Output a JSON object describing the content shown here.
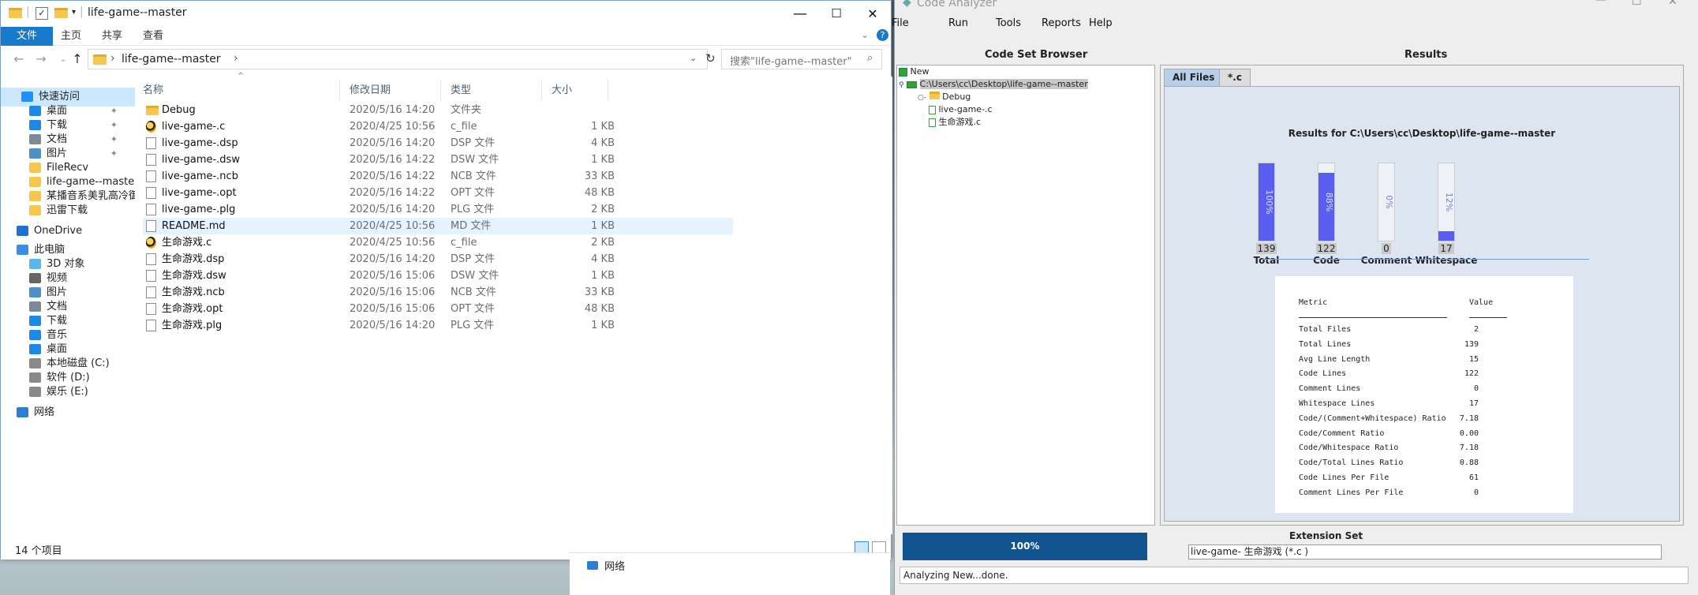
{
  "explorer": {
    "title": "life-game--master",
    "window_controls": [
      "—",
      "☐",
      "✕"
    ],
    "ribbon_tabs": [
      "文件",
      "主页",
      "共享",
      "查看"
    ],
    "address": "life-game--master",
    "search_placeholder": "搜索\"life-game--master\"",
    "sidebar": [
      {
        "label": "快速访问",
        "icon": "star-icon",
        "pinned": false,
        "selected": true
      },
      {
        "label": "桌面",
        "icon": "desktop-icon",
        "pinned": true
      },
      {
        "label": "下载",
        "icon": "download-icon",
        "pinned": true
      },
      {
        "label": "文档",
        "icon": "document-icon",
        "pinned": true
      },
      {
        "label": "图片",
        "icon": "picture-icon",
        "pinned": true
      },
      {
        "label": "FileRecv",
        "icon": "folder-icon"
      },
      {
        "label": "life-game--master",
        "icon": "folder-icon"
      },
      {
        "label": "某播音系美乳高冷御",
        "icon": "folder-icon"
      },
      {
        "label": "迅雷下载",
        "icon": "folder-icon"
      },
      {
        "label": "OneDrive",
        "icon": "cloud-icon"
      },
      {
        "label": "此电脑",
        "icon": "computer-icon"
      },
      {
        "label": "3D 对象",
        "icon": "cube-icon"
      },
      {
        "label": "视频",
        "icon": "video-icon"
      },
      {
        "label": "图片",
        "icon": "picture-icon"
      },
      {
        "label": "文档",
        "icon": "document-icon"
      },
      {
        "label": "下载",
        "icon": "download-icon"
      },
      {
        "label": "音乐",
        "icon": "music-icon"
      },
      {
        "label": "桌面",
        "icon": "desktop-icon"
      },
      {
        "label": "本地磁盘 (C:)",
        "icon": "drive-icon"
      },
      {
        "label": "软件 (D:)",
        "icon": "drive-icon"
      },
      {
        "label": "娱乐 (E:)",
        "icon": "drive-icon"
      },
      {
        "label": "网络",
        "icon": "network-icon"
      }
    ],
    "columns": [
      "名称",
      "修改日期",
      "类型",
      "大小"
    ],
    "files": [
      {
        "name": "Debug",
        "date": "2020/5/16 14:20",
        "type": "文件夹",
        "size": "",
        "icon": "folder"
      },
      {
        "name": "live-game-.c",
        "date": "2020/4/25 10:56",
        "type": "c_file",
        "size": "1 KB",
        "icon": "cfile"
      },
      {
        "name": "live-game-.dsp",
        "date": "2020/5/16 14:20",
        "type": "DSP 文件",
        "size": "4 KB",
        "icon": "doc"
      },
      {
        "name": "live-game-.dsw",
        "date": "2020/5/16 14:22",
        "type": "DSW 文件",
        "size": "1 KB",
        "icon": "doc"
      },
      {
        "name": "live-game-.ncb",
        "date": "2020/5/16 14:22",
        "type": "NCB 文件",
        "size": "33 KB",
        "icon": "doc"
      },
      {
        "name": "live-game-.opt",
        "date": "2020/5/16 14:22",
        "type": "OPT 文件",
        "size": "48 KB",
        "icon": "doc"
      },
      {
        "name": "live-game-.plg",
        "date": "2020/5/16 14:20",
        "type": "PLG 文件",
        "size": "2 KB",
        "icon": "doc"
      },
      {
        "name": "README.md",
        "date": "2020/4/25 10:56",
        "type": "MD 文件",
        "size": "1 KB",
        "icon": "doc",
        "hover": true
      },
      {
        "name": "生命游戏.c",
        "date": "2020/4/25 10:56",
        "type": "c_file",
        "size": "2 KB",
        "icon": "cfile"
      },
      {
        "name": "生命游戏.dsp",
        "date": "2020/5/16 14:20",
        "type": "DSP 文件",
        "size": "4 KB",
        "icon": "doc"
      },
      {
        "name": "生命游戏.dsw",
        "date": "2020/5/16 15:06",
        "type": "DSW 文件",
        "size": "1 KB",
        "icon": "doc"
      },
      {
        "name": "生命游戏.ncb",
        "date": "2020/5/16 15:06",
        "type": "NCB 文件",
        "size": "33 KB",
        "icon": "doc"
      },
      {
        "name": "生命游戏.opt",
        "date": "2020/5/16 15:06",
        "type": "OPT 文件",
        "size": "48 KB",
        "icon": "doc"
      },
      {
        "name": "生命游戏.plg",
        "date": "2020/5/16 14:20",
        "type": "PLG 文件",
        "size": "1 KB",
        "icon": "doc"
      }
    ],
    "status": "14 个项目"
  },
  "taskbar_fragment": {
    "label": "网络"
  },
  "analyzer": {
    "title": "Code Analyzer",
    "menus": [
      "File",
      "Run",
      "Tools",
      "Reports",
      "Help"
    ],
    "code_set_browser_title": "Code Set Browser",
    "results_title": "Results",
    "tree": {
      "root": "New",
      "path": "C:\\Users\\cc\\Desktop\\life-game--master",
      "children": [
        "Debug",
        "live-game-.c",
        "生命游戏.c"
      ]
    },
    "tabs": [
      "All Files",
      "*.c"
    ],
    "results_heading": "Results for C:\\Users\\cc\\Desktop\\life-game--master",
    "metrics_header": {
      "metric": "Metric",
      "value": "Value"
    },
    "metrics": [
      {
        "k": "Total Files",
        "v": "2"
      },
      {
        "k": "Total Lines",
        "v": "139"
      },
      {
        "k": "Avg Line Length",
        "v": "15"
      },
      {
        "k": "Code Lines",
        "v": "122"
      },
      {
        "k": "Comment Lines",
        "v": "0"
      },
      {
        "k": "Whitespace Lines",
        "v": "17"
      },
      {
        "k": "Code/(Comment+Whitespace) Ratio",
        "v": "7.18"
      },
      {
        "k": "Code/Comment Ratio",
        "v": "0.00"
      },
      {
        "k": "Code/Whitespace Ratio",
        "v": "7.18"
      },
      {
        "k": "Code/Total Lines Ratio",
        "v": "0.88"
      },
      {
        "k": "Code Lines Per File",
        "v": "61"
      },
      {
        "k": "Comment Lines Per File",
        "v": "0"
      }
    ],
    "progress_label": "100%",
    "progress_value": 1.0,
    "extension_set_title": "Extension Set",
    "extension_set_value": "live-game- 生命游戏  (*.c )",
    "status": "Analyzing New...done.",
    "bar_color": "#5a5ef0"
  },
  "chart_data": {
    "type": "bar",
    "categories": [
      "Total",
      "Code",
      "Comment",
      "Whitespace"
    ],
    "values": [
      139,
      122,
      0,
      17
    ],
    "percent_labels": [
      "100%",
      "88%",
      "0%",
      "12%"
    ],
    "ylim": [
      0,
      139
    ],
    "title": "Results for C:\\Users\\cc\\Desktop\\life-game--master"
  }
}
